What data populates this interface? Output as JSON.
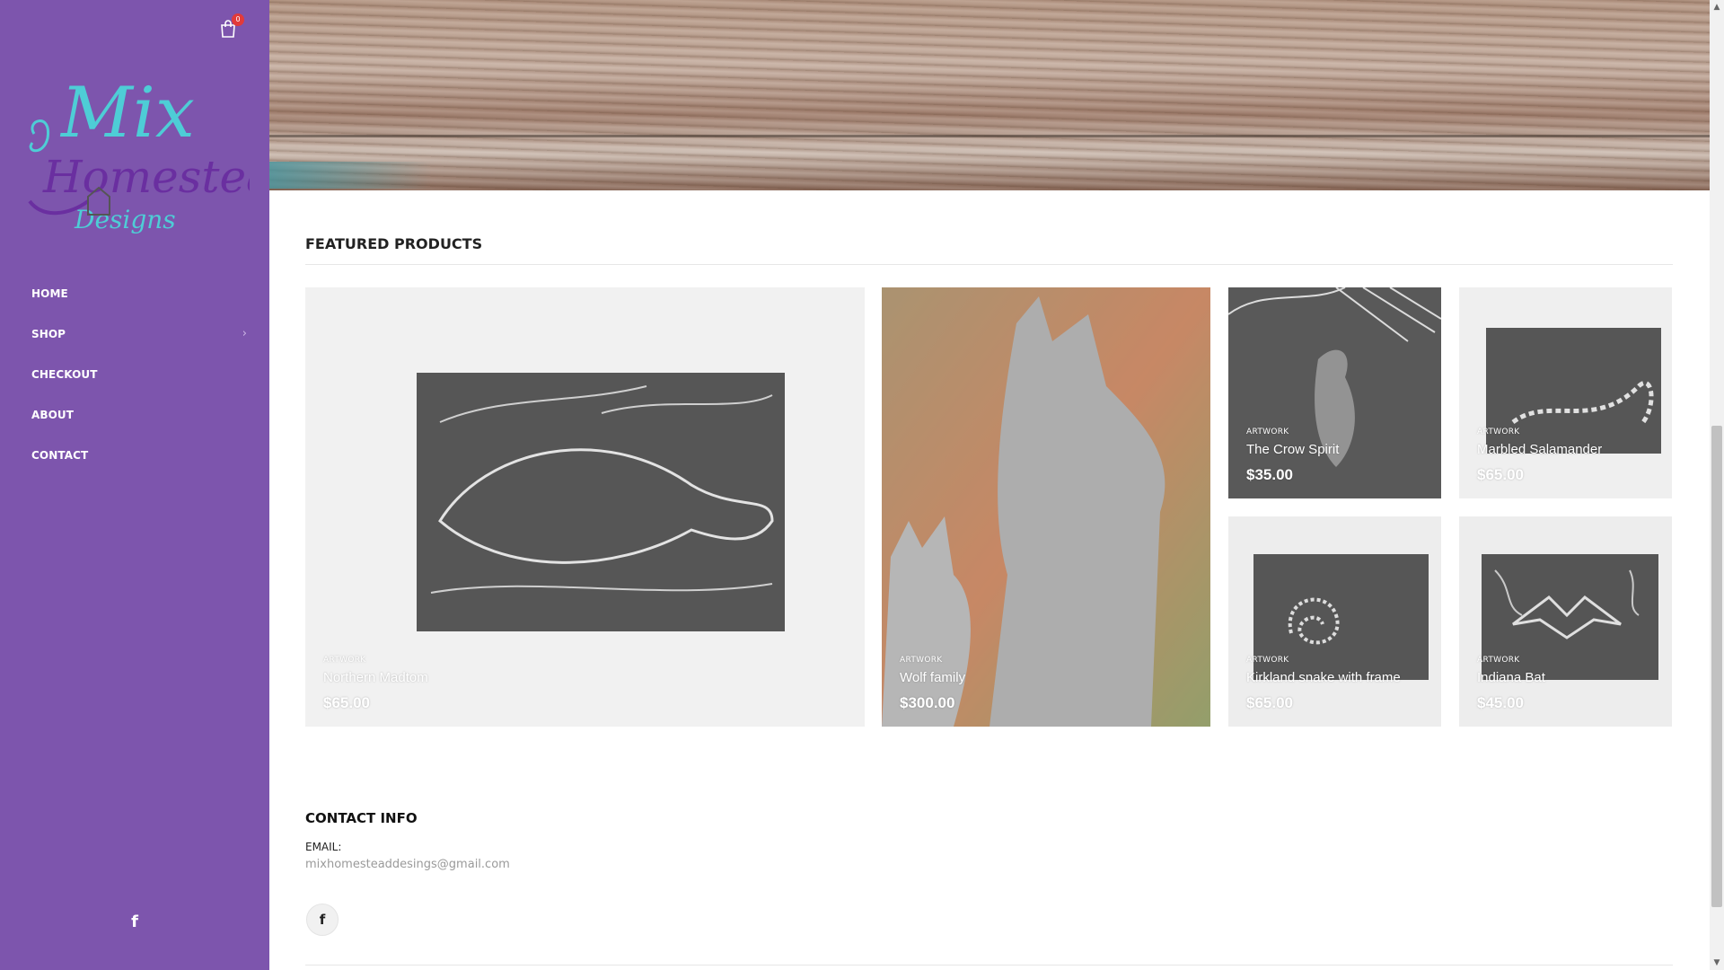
{
  "sidebar": {
    "cart_count": "0",
    "logo_text": {
      "line1": "Mix",
      "line2": "Homestead",
      "line3": "Designs"
    },
    "nav": [
      {
        "label": "HOME"
      },
      {
        "label": "SHOP",
        "has_submenu": true
      },
      {
        "label": "CHECKOUT"
      },
      {
        "label": "ABOUT"
      },
      {
        "label": "CONTACT"
      }
    ],
    "social_icon": "facebook-icon",
    "colors": {
      "background": "#7d55ad",
      "logo_teal": "#4ecdd6",
      "logo_purple": "#6a2fa0"
    }
  },
  "featured": {
    "title": "FEATURED PRODUCTS",
    "products": [
      {
        "category": "ARTWORK",
        "name": "Northern Madtom",
        "price": "$65.00"
      },
      {
        "category": "ARTWORK",
        "name": "Wolf family",
        "price": "$300.00"
      },
      {
        "category": "ARTWORK",
        "name": "The Crow Spirit",
        "price": "$35.00"
      },
      {
        "category": "ARTWORK",
        "name": "Marbled Salamander",
        "price": "$65.00"
      },
      {
        "category": "ARTWORK",
        "name": "Kirkland snake with frame",
        "price": "$65.00"
      },
      {
        "category": "ARTWORK",
        "name": "Indiana Bat",
        "price": "$45.00"
      }
    ]
  },
  "contact": {
    "title": "CONTACT INFO",
    "email_label": "EMAIL:",
    "email": "mixhomesteaddesings@gmail.com",
    "social_icon": "facebook-icon"
  }
}
